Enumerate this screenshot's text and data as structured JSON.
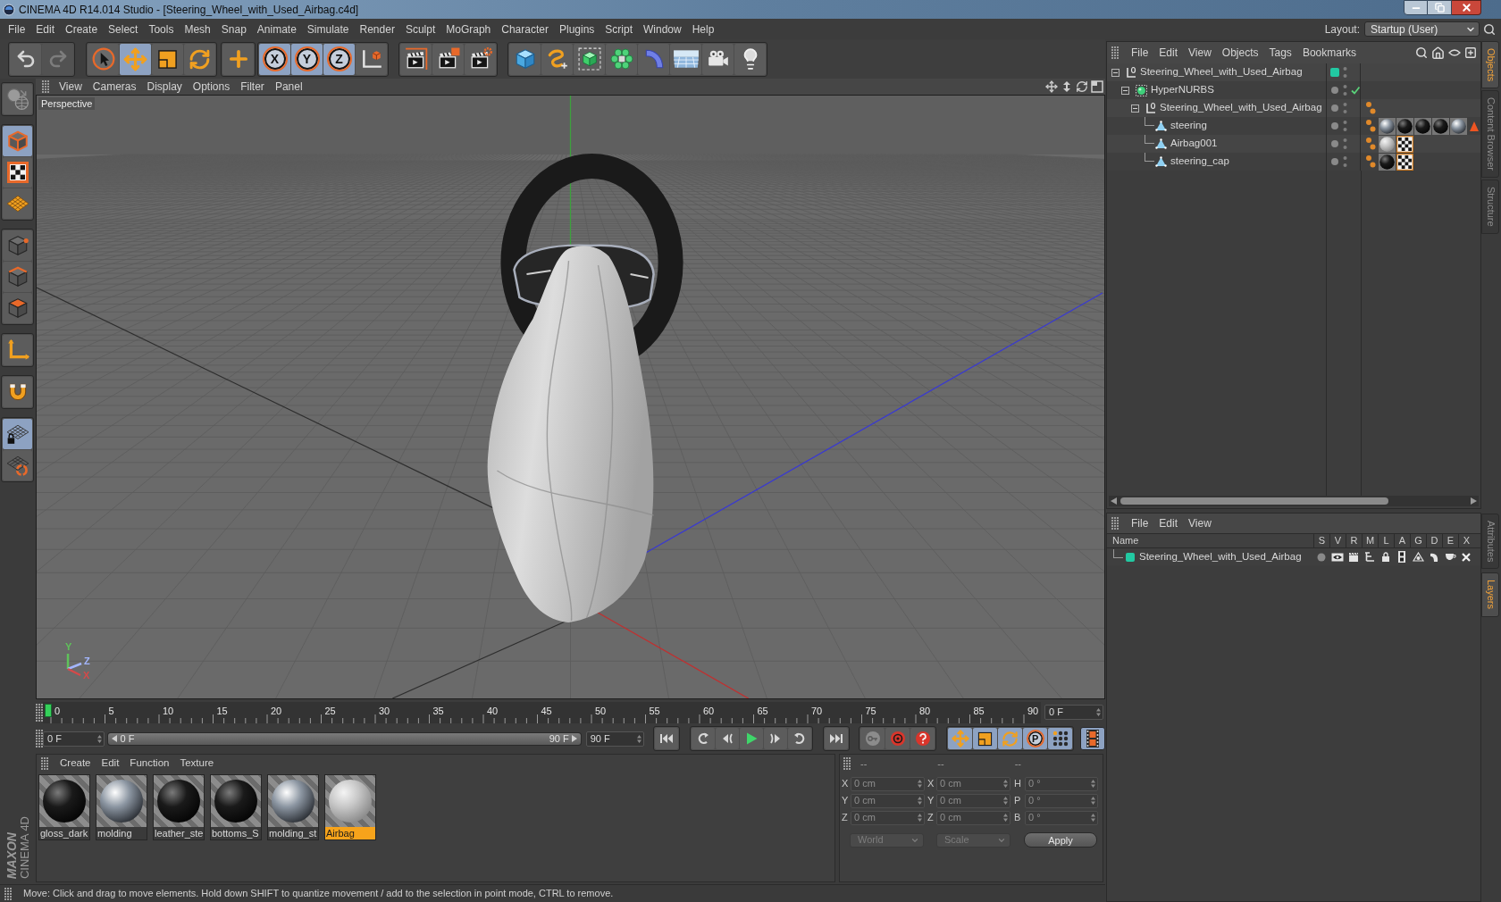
{
  "window": {
    "title": "CINEMA 4D R14.014 Studio - [Steering_Wheel_with_Used_Airbag.c4d]"
  },
  "menu_bar": [
    "File",
    "Edit",
    "Create",
    "Select",
    "Tools",
    "Mesh",
    "Snap",
    "Animate",
    "Simulate",
    "Render",
    "Sculpt",
    "MoGraph",
    "Character",
    "Plugins",
    "Script",
    "Window",
    "Help"
  ],
  "layout": {
    "label": "Layout:",
    "value": "Startup (User)"
  },
  "toolbar": [
    [
      {
        "kind": "undo",
        "disabled": false
      },
      {
        "kind": "redo",
        "disabled": true
      }
    ],
    [
      {
        "kind": "select",
        "selected": false
      },
      {
        "kind": "move",
        "selected": true
      },
      {
        "kind": "scale",
        "selected": false
      },
      {
        "kind": "rotate",
        "selected": false
      }
    ],
    [
      {
        "kind": "add",
        "selected": false
      }
    ],
    [
      {
        "kind": "axis",
        "label": "X",
        "selected": true
      },
      {
        "kind": "axis",
        "label": "Y",
        "selected": true
      },
      {
        "kind": "axis",
        "label": "Z",
        "selected": true
      },
      {
        "kind": "coordinates",
        "selected": false
      }
    ],
    [
      {
        "kind": "render-view"
      },
      {
        "kind": "render-picture"
      },
      {
        "kind": "render-settings"
      }
    ],
    [
      {
        "kind": "cube"
      },
      {
        "kind": "spline"
      },
      {
        "kind": "nurbs"
      },
      {
        "kind": "array"
      },
      {
        "kind": "deformer"
      },
      {
        "kind": "floor"
      },
      {
        "kind": "camera"
      },
      {
        "kind": "light"
      }
    ]
  ],
  "mode_bar": [
    [
      {
        "kind": "make-editable",
        "selected": false
      }
    ],
    [
      {
        "kind": "model",
        "selected": true
      },
      {
        "kind": "texture",
        "selected": false
      },
      {
        "kind": "workplane",
        "selected": false
      }
    ],
    [
      {
        "kind": "points",
        "selected": false
      },
      {
        "kind": "edges",
        "selected": false
      },
      {
        "kind": "polygons",
        "selected": false
      }
    ],
    [
      {
        "kind": "axis",
        "selected": false
      }
    ],
    [
      {
        "kind": "snap",
        "selected": false
      }
    ],
    [
      {
        "kind": "workplane-lock",
        "selected": true
      },
      {
        "kind": "quantize",
        "selected": false
      }
    ]
  ],
  "logo": {
    "brand": "MAXON",
    "product": "CINEMA 4D"
  },
  "viewport": {
    "menu": [
      "View",
      "Cameras",
      "Display",
      "Options",
      "Filter",
      "Panel"
    ],
    "camera": "Perspective",
    "gizmo": [
      {
        "label": "Y",
        "color": "#5fc25a"
      },
      {
        "label": "Z",
        "color": "#a3b6ff"
      },
      {
        "label": "X",
        "color": "#d44a4a"
      }
    ]
  },
  "timeline": {
    "ticks": [
      "0",
      "5",
      "10",
      "15",
      "20",
      "25",
      "30",
      "35",
      "40",
      "45",
      "50",
      "55",
      "60",
      "65",
      "70",
      "75",
      "80",
      "85",
      "90"
    ],
    "playhead": {
      "level": 0
    },
    "current_frame": "0 F"
  },
  "transport": {
    "start": "0 F",
    "range": {
      "from": "0 F",
      "to": "90 F",
      "level": 1
    },
    "end": "90 F",
    "playback": [
      [
        {
          "kind": "go-start"
        }
      ],
      [
        {
          "kind": "prev-key"
        },
        {
          "kind": "prev-frame"
        },
        {
          "kind": "play"
        },
        {
          "kind": "next-frame"
        },
        {
          "kind": "next-key"
        }
      ],
      [
        {
          "kind": "go-end"
        }
      ]
    ],
    "record": [
      {
        "kind": "autokey"
      },
      {
        "kind": "record"
      },
      {
        "kind": "help"
      }
    ],
    "keys": [
      {
        "kind": "move",
        "selected": true
      },
      {
        "kind": "scale",
        "selected": true
      },
      {
        "kind": "rotate",
        "selected": true
      },
      {
        "kind": "parameter",
        "label": "P",
        "selected": true
      },
      {
        "kind": "points",
        "selected": true
      }
    ],
    "timeline_button": {
      "selected": true
    }
  },
  "materials": {
    "menu": [
      "Create",
      "Edit",
      "Function",
      "Texture"
    ],
    "items": [
      {
        "name": "gloss_dark",
        "kind": "black",
        "selected": false
      },
      {
        "name": "molding",
        "kind": "chrome",
        "selected": false
      },
      {
        "name": "leather_ste",
        "kind": "black",
        "selected": false
      },
      {
        "name": "bottoms_S",
        "kind": "black",
        "selected": false
      },
      {
        "name": "molding_st",
        "kind": "chrome",
        "selected": false
      },
      {
        "name": "Airbag",
        "kind": "white",
        "selected": true
      }
    ]
  },
  "coordinates": {
    "headers": [
      "--",
      "--",
      "--"
    ],
    "rows": [
      [
        {
          "axis": "X",
          "value": "0 cm"
        },
        {
          "axis": "X",
          "value": "0 cm"
        },
        {
          "axis": "H",
          "value": "0 °"
        }
      ],
      [
        {
          "axis": "Y",
          "value": "0 cm"
        },
        {
          "axis": "Y",
          "value": "0 cm"
        },
        {
          "axis": "P",
          "value": "0 °"
        }
      ],
      [
        {
          "axis": "Z",
          "value": "0 cm"
        },
        {
          "axis": "Z",
          "value": "0 cm"
        },
        {
          "axis": "B",
          "value": "0 °"
        }
      ]
    ],
    "dropdowns": [
      {
        "label": "World",
        "disabled": true
      },
      {
        "label": "Scale",
        "disabled": true
      }
    ],
    "apply": "Apply"
  },
  "status_bar": "Move: Click and drag to move elements. Hold down SHIFT to quantize movement / add to the selection in point mode, CTRL to remove.",
  "objects": {
    "menu": [
      "File",
      "Edit",
      "View",
      "Objects",
      "Tags",
      "Bookmarks"
    ],
    "tree": [
      {
        "name": "Steering_Wheel_with_Used_Airbag",
        "kind": "null",
        "expanded": true,
        "color": "#22c9a2",
        "children": [
          {
            "name": "HyperNURBS",
            "kind": "hypernurbs",
            "expanded": true,
            "enabled": true,
            "children": [
              {
                "name": "Steering_Wheel_with_Used_Airbag",
                "kind": "null",
                "expanded": true,
                "tags": [
                  {
                    "kind": "phong"
                  }
                ],
                "children": [
                  {
                    "name": "steering",
                    "kind": "polygon",
                    "tags": [
                      {
                        "kind": "phong"
                      },
                      {
                        "kind": "material-chrome"
                      },
                      {
                        "kind": "material-black"
                      },
                      {
                        "kind": "material-black"
                      },
                      {
                        "kind": "material-black"
                      },
                      {
                        "kind": "material-chrome"
                      },
                      {
                        "kind": "warning"
                      }
                    ]
                  },
                  {
                    "name": "Airbag001",
                    "kind": "polygon",
                    "tags": [
                      {
                        "kind": "phong"
                      },
                      {
                        "kind": "material-white"
                      },
                      {
                        "kind": "texture"
                      }
                    ]
                  },
                  {
                    "name": "steering_cap",
                    "kind": "polygon",
                    "tags": [
                      {
                        "kind": "phong"
                      },
                      {
                        "kind": "material-black"
                      },
                      {
                        "kind": "texture"
                      }
                    ]
                  }
                ]
              }
            ]
          }
        ]
      }
    ]
  },
  "layers": {
    "menu": [
      "File",
      "Edit",
      "View"
    ],
    "columns": [
      "Name",
      "S",
      "V",
      "R",
      "M",
      "L",
      "A",
      "G",
      "D",
      "E",
      "X"
    ],
    "rows": [
      {
        "name": "Steering_Wheel_with_Used_Airbag",
        "color": "#22c9a2"
      }
    ]
  },
  "side_tabs": {
    "upper": [
      {
        "label": "Objects",
        "selected": true
      },
      {
        "label": "Content Browser",
        "selected": false
      },
      {
        "label": "Structure",
        "selected": false
      }
    ],
    "lower": [
      {
        "label": "Attributes",
        "selected": false
      },
      {
        "label": "Layers",
        "selected": true
      }
    ]
  }
}
